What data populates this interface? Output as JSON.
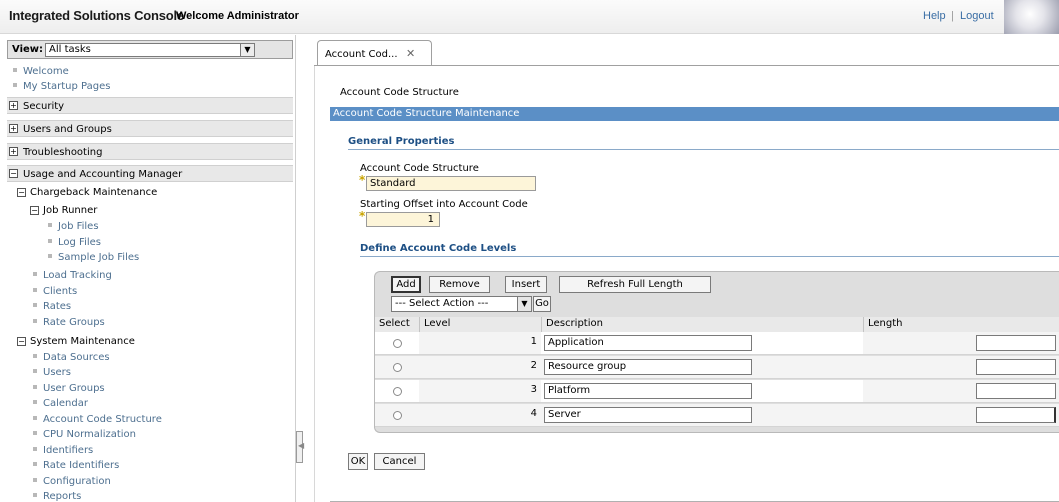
{
  "banner": {
    "title": "Integrated Solutions Console",
    "welcome": "Welcome Administrator",
    "help": "Help",
    "separator": "|",
    "logout": "Logout"
  },
  "nav": {
    "view_label": "View:",
    "view_value": "All tasks",
    "top_links": [
      "Welcome",
      "My Startup Pages"
    ],
    "sections": {
      "security": "Security",
      "users_groups": "Users and Groups",
      "troubleshooting": "Troubleshooting",
      "uam": "Usage and Accounting Manager"
    },
    "chargeback": {
      "label": "Chargeback Maintenance",
      "job_runner": "Job Runner",
      "job_runner_items": [
        "Job Files",
        "Log Files",
        "Sample Job Files"
      ],
      "items": [
        "Load Tracking",
        "Clients",
        "Rates",
        "Rate Groups"
      ]
    },
    "system_maintenance": {
      "label": "System Maintenance",
      "items": [
        "Data Sources",
        "Users",
        "User Groups",
        "Calendar",
        "Account Code Structure",
        "CPU Normalization",
        "Identifiers",
        "Rate Identifiers",
        "Configuration",
        "Reports"
      ]
    }
  },
  "workspace": {
    "tab_label": "Account Cod...",
    "tab_close": "✕",
    "breadcrumb": "Account Code Structure",
    "portlet_title": "Account Code Structure Maintenance",
    "general_properties": "General Properties",
    "acs_label": "Account Code Structure",
    "acs_value": "Standard",
    "offset_label": "Starting Offset into Account Code",
    "offset_value": "1",
    "define_levels": "Define Account Code Levels",
    "buttons": {
      "add": "Add",
      "remove": "Remove",
      "insert": "Insert",
      "refresh": "Refresh Full Length",
      "go": "Go"
    },
    "action_select": "--- Select Action ---",
    "columns": {
      "select": "Select",
      "level": "Level",
      "description": "Description",
      "length": "Length"
    },
    "rows": [
      {
        "level": "1",
        "description": "Application"
      },
      {
        "level": "2",
        "description": "Resource group"
      },
      {
        "level": "3",
        "description": "Platform"
      },
      {
        "level": "4",
        "description": "Server"
      }
    ],
    "ok": "OK",
    "cancel": "Cancel"
  }
}
